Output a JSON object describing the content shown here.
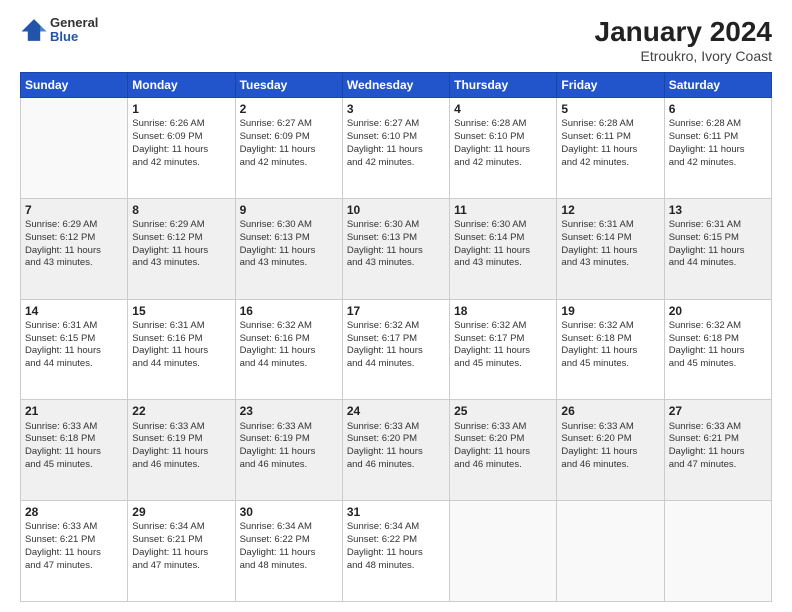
{
  "header": {
    "logo": {
      "general": "General",
      "blue": "Blue"
    },
    "title": "January 2024",
    "subtitle": "Etroukro, Ivory Coast"
  },
  "weekdays": [
    "Sunday",
    "Monday",
    "Tuesday",
    "Wednesday",
    "Thursday",
    "Friday",
    "Saturday"
  ],
  "weeks": [
    [
      {
        "day": "",
        "info": ""
      },
      {
        "day": "1",
        "info": "Sunrise: 6:26 AM\nSunset: 6:09 PM\nDaylight: 11 hours\nand 42 minutes."
      },
      {
        "day": "2",
        "info": "Sunrise: 6:27 AM\nSunset: 6:09 PM\nDaylight: 11 hours\nand 42 minutes."
      },
      {
        "day": "3",
        "info": "Sunrise: 6:27 AM\nSunset: 6:10 PM\nDaylight: 11 hours\nand 42 minutes."
      },
      {
        "day": "4",
        "info": "Sunrise: 6:28 AM\nSunset: 6:10 PM\nDaylight: 11 hours\nand 42 minutes."
      },
      {
        "day": "5",
        "info": "Sunrise: 6:28 AM\nSunset: 6:11 PM\nDaylight: 11 hours\nand 42 minutes."
      },
      {
        "day": "6",
        "info": "Sunrise: 6:28 AM\nSunset: 6:11 PM\nDaylight: 11 hours\nand 42 minutes."
      }
    ],
    [
      {
        "day": "7",
        "info": "Sunrise: 6:29 AM\nSunset: 6:12 PM\nDaylight: 11 hours\nand 43 minutes."
      },
      {
        "day": "8",
        "info": "Sunrise: 6:29 AM\nSunset: 6:12 PM\nDaylight: 11 hours\nand 43 minutes."
      },
      {
        "day": "9",
        "info": "Sunrise: 6:30 AM\nSunset: 6:13 PM\nDaylight: 11 hours\nand 43 minutes."
      },
      {
        "day": "10",
        "info": "Sunrise: 6:30 AM\nSunset: 6:13 PM\nDaylight: 11 hours\nand 43 minutes."
      },
      {
        "day": "11",
        "info": "Sunrise: 6:30 AM\nSunset: 6:14 PM\nDaylight: 11 hours\nand 43 minutes."
      },
      {
        "day": "12",
        "info": "Sunrise: 6:31 AM\nSunset: 6:14 PM\nDaylight: 11 hours\nand 43 minutes."
      },
      {
        "day": "13",
        "info": "Sunrise: 6:31 AM\nSunset: 6:15 PM\nDaylight: 11 hours\nand 44 minutes."
      }
    ],
    [
      {
        "day": "14",
        "info": "Sunrise: 6:31 AM\nSunset: 6:15 PM\nDaylight: 11 hours\nand 44 minutes."
      },
      {
        "day": "15",
        "info": "Sunrise: 6:31 AM\nSunset: 6:16 PM\nDaylight: 11 hours\nand 44 minutes."
      },
      {
        "day": "16",
        "info": "Sunrise: 6:32 AM\nSunset: 6:16 PM\nDaylight: 11 hours\nand 44 minutes."
      },
      {
        "day": "17",
        "info": "Sunrise: 6:32 AM\nSunset: 6:17 PM\nDaylight: 11 hours\nand 44 minutes."
      },
      {
        "day": "18",
        "info": "Sunrise: 6:32 AM\nSunset: 6:17 PM\nDaylight: 11 hours\nand 45 minutes."
      },
      {
        "day": "19",
        "info": "Sunrise: 6:32 AM\nSunset: 6:18 PM\nDaylight: 11 hours\nand 45 minutes."
      },
      {
        "day": "20",
        "info": "Sunrise: 6:32 AM\nSunset: 6:18 PM\nDaylight: 11 hours\nand 45 minutes."
      }
    ],
    [
      {
        "day": "21",
        "info": "Sunrise: 6:33 AM\nSunset: 6:18 PM\nDaylight: 11 hours\nand 45 minutes."
      },
      {
        "day": "22",
        "info": "Sunrise: 6:33 AM\nSunset: 6:19 PM\nDaylight: 11 hours\nand 46 minutes."
      },
      {
        "day": "23",
        "info": "Sunrise: 6:33 AM\nSunset: 6:19 PM\nDaylight: 11 hours\nand 46 minutes."
      },
      {
        "day": "24",
        "info": "Sunrise: 6:33 AM\nSunset: 6:20 PM\nDaylight: 11 hours\nand 46 minutes."
      },
      {
        "day": "25",
        "info": "Sunrise: 6:33 AM\nSunset: 6:20 PM\nDaylight: 11 hours\nand 46 minutes."
      },
      {
        "day": "26",
        "info": "Sunrise: 6:33 AM\nSunset: 6:20 PM\nDaylight: 11 hours\nand 46 minutes."
      },
      {
        "day": "27",
        "info": "Sunrise: 6:33 AM\nSunset: 6:21 PM\nDaylight: 11 hours\nand 47 minutes."
      }
    ],
    [
      {
        "day": "28",
        "info": "Sunrise: 6:33 AM\nSunset: 6:21 PM\nDaylight: 11 hours\nand 47 minutes."
      },
      {
        "day": "29",
        "info": "Sunrise: 6:34 AM\nSunset: 6:21 PM\nDaylight: 11 hours\nand 47 minutes."
      },
      {
        "day": "30",
        "info": "Sunrise: 6:34 AM\nSunset: 6:22 PM\nDaylight: 11 hours\nand 48 minutes."
      },
      {
        "day": "31",
        "info": "Sunrise: 6:34 AM\nSunset: 6:22 PM\nDaylight: 11 hours\nand 48 minutes."
      },
      {
        "day": "",
        "info": ""
      },
      {
        "day": "",
        "info": ""
      },
      {
        "day": "",
        "info": ""
      }
    ]
  ]
}
